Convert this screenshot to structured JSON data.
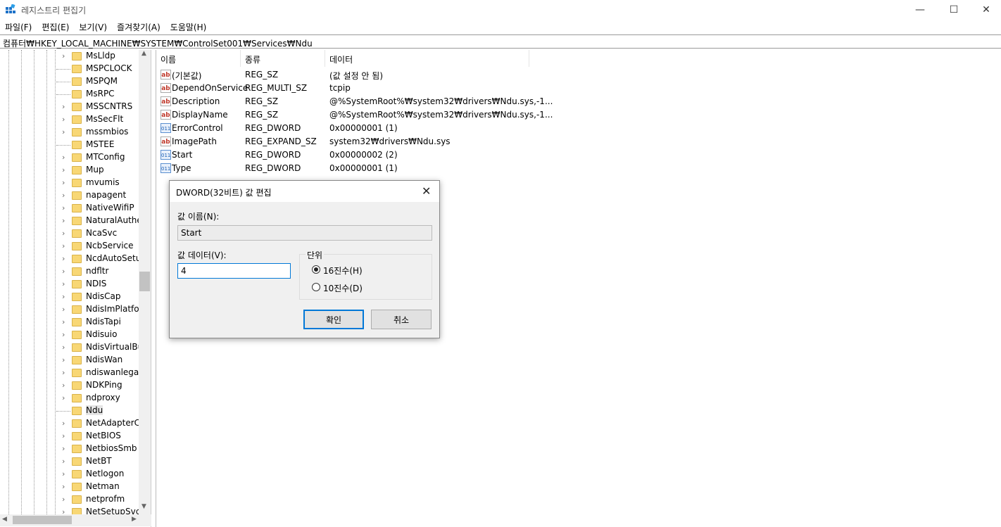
{
  "window": {
    "title": "레지스트리 편집기",
    "minimize": "—",
    "maximize": "☐",
    "close": "✕"
  },
  "menu": [
    "파일(F)",
    "편집(E)",
    "보기(V)",
    "즐겨찾기(A)",
    "도움말(H)"
  ],
  "address": "컴퓨터₩HKEY_LOCAL_MACHINE₩SYSTEM₩ControlSet001₩Services₩Ndu",
  "tree": {
    "items": [
      {
        "label": "MsLldp",
        "expandable": true
      },
      {
        "label": "MSPCLOCK",
        "expandable": false
      },
      {
        "label": "MSPQM",
        "expandable": false
      },
      {
        "label": "MsRPC",
        "expandable": false
      },
      {
        "label": "MSSCNTRS",
        "expandable": true
      },
      {
        "label": "MsSecFlt",
        "expandable": true
      },
      {
        "label": "mssmbios",
        "expandable": true
      },
      {
        "label": "MSTEE",
        "expandable": false
      },
      {
        "label": "MTConfig",
        "expandable": true
      },
      {
        "label": "Mup",
        "expandable": true
      },
      {
        "label": "mvumis",
        "expandable": true
      },
      {
        "label": "napagent",
        "expandable": true
      },
      {
        "label": "NativeWifiP",
        "expandable": true
      },
      {
        "label": "NaturalAuthen",
        "expandable": true
      },
      {
        "label": "NcaSvc",
        "expandable": true
      },
      {
        "label": "NcbService",
        "expandable": true
      },
      {
        "label": "NcdAutoSetup",
        "expandable": true
      },
      {
        "label": "ndfltr",
        "expandable": true
      },
      {
        "label": "NDIS",
        "expandable": true
      },
      {
        "label": "NdisCap",
        "expandable": true
      },
      {
        "label": "NdisImPlatform",
        "expandable": true
      },
      {
        "label": "NdisTapi",
        "expandable": true
      },
      {
        "label": "Ndisuio",
        "expandable": true
      },
      {
        "label": "NdisVirtualBus",
        "expandable": true
      },
      {
        "label": "NdisWan",
        "expandable": true
      },
      {
        "label": "ndiswanlegacy",
        "expandable": true
      },
      {
        "label": "NDKPing",
        "expandable": true
      },
      {
        "label": "ndproxy",
        "expandable": true
      },
      {
        "label": "Ndu",
        "expandable": false,
        "selected": true
      },
      {
        "label": "NetAdapterCx",
        "expandable": true
      },
      {
        "label": "NetBIOS",
        "expandable": true
      },
      {
        "label": "NetbiosSmb",
        "expandable": true
      },
      {
        "label": "NetBT",
        "expandable": true
      },
      {
        "label": "Netlogon",
        "expandable": true
      },
      {
        "label": "Netman",
        "expandable": true
      },
      {
        "label": "netprofm",
        "expandable": true
      },
      {
        "label": "NetSetupSvc",
        "expandable": true
      }
    ]
  },
  "list": {
    "columns": [
      "이름",
      "종류",
      "데이터"
    ],
    "rows": [
      {
        "icon": "string-value-icon",
        "name": "(기본값)",
        "type": "REG_SZ",
        "data": "(값 설정 안 됨)"
      },
      {
        "icon": "string-value-icon",
        "name": "DependOnService",
        "type": "REG_MULTI_SZ",
        "data": "tcpip"
      },
      {
        "icon": "string-value-icon",
        "name": "Description",
        "type": "REG_SZ",
        "data": "@%SystemRoot%₩system32₩drivers₩Ndu.sys,-1..."
      },
      {
        "icon": "string-value-icon",
        "name": "DisplayName",
        "type": "REG_SZ",
        "data": "@%SystemRoot%₩system32₩drivers₩Ndu.sys,-1..."
      },
      {
        "icon": "binary-value-icon",
        "name": "ErrorControl",
        "type": "REG_DWORD",
        "data": "0x00000001 (1)"
      },
      {
        "icon": "string-value-icon",
        "name": "ImagePath",
        "type": "REG_EXPAND_SZ",
        "data": "system32₩drivers₩Ndu.sys"
      },
      {
        "icon": "binary-value-icon",
        "name": "Start",
        "type": "REG_DWORD",
        "data": "0x00000002 (2)"
      },
      {
        "icon": "binary-value-icon",
        "name": "Type",
        "type": "REG_DWORD",
        "data": "0x00000001 (1)"
      }
    ]
  },
  "dialog": {
    "title": "DWORD(32비트) 값 편집",
    "close": "✕",
    "name_label": "값 이름(N):",
    "name_value": "Start",
    "data_label": "값 데이터(V):",
    "data_value": "4",
    "base_label": "단위",
    "hex_label": "16진수(H)",
    "dec_label": "10진수(D)",
    "base_selected": "hex",
    "ok": "확인",
    "cancel": "취소"
  },
  "colors": {
    "accent": "#0078d7",
    "folder": "#f8d775"
  }
}
